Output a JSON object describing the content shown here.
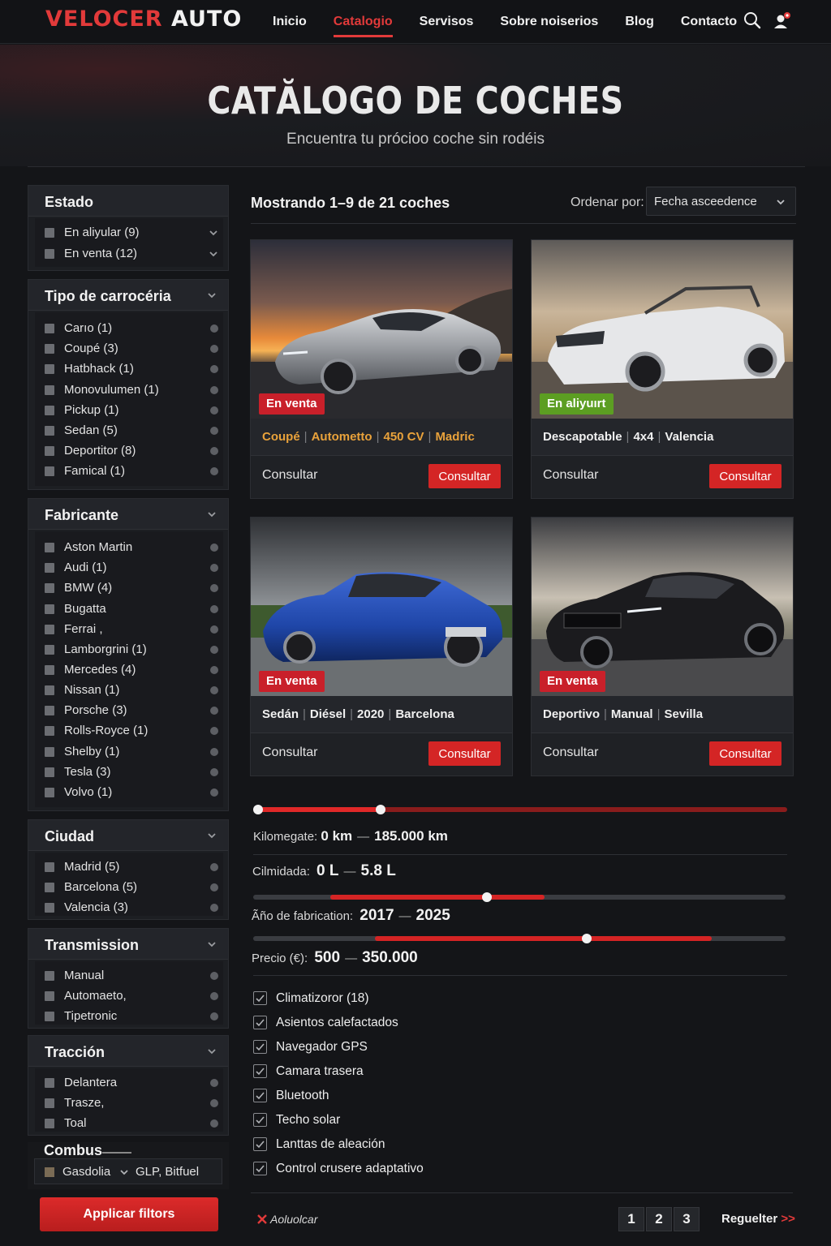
{
  "brand": {
    "part1": "VELOCER",
    "part2": " AUTO"
  },
  "nav": {
    "items": [
      {
        "label": "Inicio",
        "active": false
      },
      {
        "label": "Catalogio",
        "active": true
      },
      {
        "label": "Servisos",
        "active": false
      },
      {
        "label": "Sobre noiserios",
        "active": false
      },
      {
        "label": "Blog",
        "active": false
      },
      {
        "label": "Contacto",
        "active": false
      }
    ],
    "search_icon": "search-icon",
    "user_icon": "user-notification-icon"
  },
  "hero": {
    "title": "CATĂLOGO DE COCHES",
    "subtitle": "Encuentra tu prócioo coche sin rodéis"
  },
  "filters": {
    "estado": {
      "title": "Estado",
      "items": [
        "En aliyular (9)",
        "En venta (12)"
      ]
    },
    "carroceria": {
      "title": "Tipo de carrocéria",
      "items": [
        "Carıo (1)",
        "Coupé (3)",
        "Hatbhack (1)",
        "Monovulumen (1)",
        "Pickup (1)",
        "Sedan (5)",
        "Deportitor (8)",
        "Famical (1)"
      ]
    },
    "fabricante": {
      "title": "Fabricante",
      "items": [
        "Aston Martin",
        "Audi (1)",
        "BMW (4)",
        "Bugatta",
        "Ferrai ,",
        "Lamborgrini (1)",
        "Mercedes (4)",
        "Nissan (1)",
        "Porsche (3)",
        "Rolls-Royce (1)",
        "Shelby (1)",
        "Tesla (3)",
        "Volvo (1)"
      ]
    },
    "ciudad": {
      "title": "Ciudad",
      "items": [
        "Madrid (5)",
        "Barcelona (5)",
        "Valencia (3)"
      ]
    },
    "transmission": {
      "title": "Transmission",
      "items": [
        "Manual",
        "Automaeto,",
        "Tipetronic"
      ]
    },
    "traccion": {
      "title": "Tracción",
      "items": [
        "Delantera",
        "Trasze,",
        "Toal"
      ]
    },
    "combustible": {
      "title": "Combus",
      "option1": "Gasdolia",
      "option2": "GLP,  Bitfuel"
    },
    "apply_label": "Applicar filtors"
  },
  "results": {
    "summary": "Mostrando 1–9 de 21 coches",
    "sort_label": "Ordenar por:",
    "sort_value": "Fecha asceedence"
  },
  "cars": [
    {
      "badge": "En venta",
      "badge_color": "#c9202a",
      "specs": [
        "Coupé",
        "Autometto",
        "450 CV",
        "Madric"
      ],
      "specs_color": "#e9a23b",
      "footer_label": "Consultar",
      "cta_label": "Consultar",
      "image": "silver-coupe-sunset"
    },
    {
      "badge": "En aliyuırt",
      "badge_color": "#5c9e22",
      "specs": [
        "Descapotable",
        "4x4",
        "Valencia"
      ],
      "specs_color": "#f0f0f0",
      "footer_label": "Consultar",
      "cta_label": "Consultar",
      "image": "white-convertible-suv"
    },
    {
      "badge": "En venta",
      "badge_color": "#c9202a",
      "specs": [
        "Sedán",
        "Diésel",
        "2020",
        "Barcelona"
      ],
      "specs_color": "#f0f0f0",
      "footer_label": "Consultar",
      "cta_label": "Consultar",
      "image": "blue-sedan"
    },
    {
      "badge": "En venta",
      "badge_color": "#c9202a",
      "specs": [
        "Deportivo",
        "Manual",
        "Sevilla"
      ],
      "specs_color": "#f0f0f0",
      "footer_label": "Consultar",
      "cta_label": "Consultar",
      "image": "black-sports-car"
    }
  ],
  "ranges": {
    "kilometraje": {
      "label": "Kilomegate:",
      "min": "0 km",
      "max": "185.000 km",
      "fill_end": 0.23
    },
    "consumo": {
      "label": "Cilmidada:",
      "min": "0 L",
      "max": "5.8 L"
    },
    "ano": {
      "label": "Ãño de fabrication:",
      "min": "2017",
      "max": "2025"
    },
    "precio": {
      "label": "Precio (€):",
      "min": "500",
      "max": "350.000"
    }
  },
  "features": [
    "Climatizoror (18)",
    "Asientos calefactados",
    "Navegador GPS",
    "Camara trasera",
    "Bluetooth",
    "Techo solar",
    "Lanttas de aleación",
    "Control crusere adaptativo"
  ],
  "pagination": {
    "reset_label": "Aoluolcar",
    "pages": [
      "1",
      "2",
      "3"
    ],
    "next_label": "Reguelter",
    "next_arrow": ">>"
  }
}
